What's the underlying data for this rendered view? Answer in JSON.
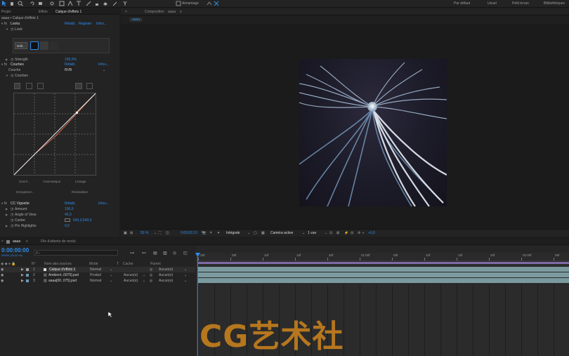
{
  "toolbar": {
    "snap_label": "Aimantage",
    "workspaces": [
      "Par défaut",
      "Usuel",
      "Petit écran",
      "Bibliothèques"
    ]
  },
  "effect_panel": {
    "tab_project": "Projet",
    "tab_effects": "Effets",
    "tab_layer": "Calque d'effets 1",
    "header": "aaaa • Calque d'effets 1",
    "looks": {
      "name": "Looks",
      "reset": "Rétabl.",
      "register": "Register",
      "info": "Infos..."
    },
    "look_label": "Look",
    "edit_button": "Edit...",
    "strength": {
      "label": "Strength",
      "value": "100,0%"
    },
    "curves": {
      "name": "Courbes",
      "reset": "Rétabl.",
      "info": "Infos..."
    },
    "channel": {
      "label": "Couche",
      "value": "RVB"
    },
    "curves_label": "Courbes",
    "curve_buttons": {
      "open": "Ouvrir...",
      "auto": "Automatique",
      "smooth": "Lissage",
      "save": "Enregistrer...",
      "reset": "Réinitialiser"
    },
    "vignette": {
      "name": "CC Vignette",
      "reset": "Rétabl.",
      "info": "Infos..."
    },
    "amount": {
      "label": "Amount",
      "value": "100,0"
    },
    "angle": {
      "label": "Angle of View",
      "value": "45,0"
    },
    "center": {
      "label": "Center",
      "value": "540,0,540,0"
    },
    "pin": {
      "label": "Pin Highlights",
      "value": "0,0"
    }
  },
  "composition": {
    "tab_label": "Composition",
    "comp_name": "aaaa",
    "sub_tab": "aaaa",
    "zoom": "50 %",
    "timecode": "0:00:02:13",
    "resolution": "Intégrale",
    "camera": "Caméra active",
    "views": "1 vue",
    "exposure": "+0,0"
  },
  "timeline": {
    "comp_tab": "aaaa",
    "render_queue_tab": "File d'attente de rendu",
    "current_time": "0:00:00:00",
    "frame_info": "00000 (25,00 i/s)",
    "search_placeholder": "ρ⌄",
    "col_num": "N°",
    "col_source": "Nom des sources",
    "col_mode": "Mode",
    "col_t": "T",
    "col_matte": "Cache",
    "col_parent": "Parent",
    "ruler_labels": [
      ":00f",
      "05f",
      "10f",
      "15f",
      "20f",
      "01:00f",
      "05f",
      "10f",
      "15f",
      "20f",
      "02:00f",
      "05f"
    ],
    "layers": [
      {
        "num": "1",
        "name": "Calque d'effets 1",
        "mode": "Normal",
        "matte": "",
        "parent": "Aucun(e)"
      },
      {
        "num": "2",
        "name": "Ambient..0075].psd",
        "mode": "Produit",
        "matte": "Aucun(e)",
        "parent": "Aucun(e)"
      },
      {
        "num": "3",
        "name": "aaaa[00..075].psd",
        "mode": "Normal",
        "matte": "Aucun(e)",
        "parent": "Aucun(e)"
      }
    ]
  },
  "watermark": "CG艺术社",
  "colors": {
    "accent": "#2d8ceb",
    "track": "#7b9aa0",
    "playhead": "#2d8ceb"
  }
}
